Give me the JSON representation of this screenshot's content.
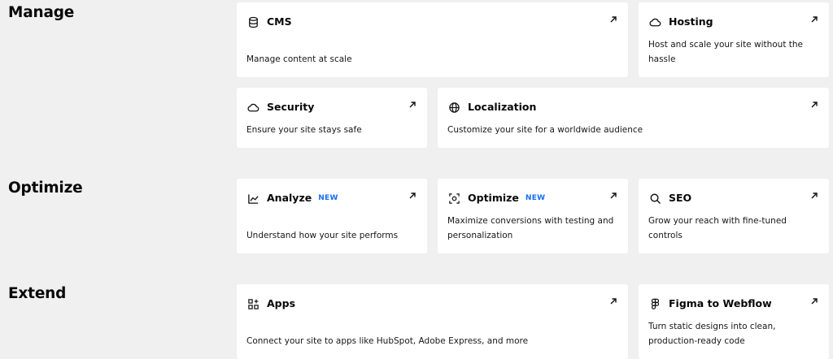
{
  "sections": {
    "manage": {
      "title": "Manage",
      "cms": {
        "title": "CMS",
        "desc": "Manage content at scale"
      },
      "hosting": {
        "title": "Hosting",
        "desc": "Host and scale your site without the hassle"
      },
      "security": {
        "title": "Security",
        "desc": "Ensure your site stays safe"
      },
      "localization": {
        "title": "Localization",
        "desc": "Customize your site for a worldwide audience"
      }
    },
    "optimize": {
      "title": "Optimize",
      "analyze": {
        "title": "Analyze",
        "badge": "NEW",
        "desc": "Understand how your site performs"
      },
      "optimize": {
        "title": "Optimize",
        "badge": "NEW",
        "desc": "Maximize conversions with testing and personalization"
      },
      "seo": {
        "title": "SEO",
        "desc": "Grow your reach with fine-tuned controls"
      }
    },
    "extend": {
      "title": "Extend",
      "apps": {
        "title": "Apps",
        "desc": "Connect your site to apps like HubSpot, Adobe Express, and more"
      },
      "figma": {
        "title": "Figma to Webflow",
        "desc": "Turn static designs into clean, production-ready code"
      }
    }
  },
  "icons": {
    "cms": "database-icon",
    "hosting": "cloud-icon",
    "security": "cloud-icon",
    "localization": "globe-icon",
    "analyze": "line-chart-icon",
    "optimize": "target-icon",
    "seo": "search-icon",
    "apps": "apps-grid-icon",
    "figma": "figma-icon",
    "external": "arrow-up-right-icon"
  },
  "colors": {
    "background": "#f0f0f0",
    "card": "#ffffff",
    "text": "#080808",
    "badge": "#146ef5"
  }
}
